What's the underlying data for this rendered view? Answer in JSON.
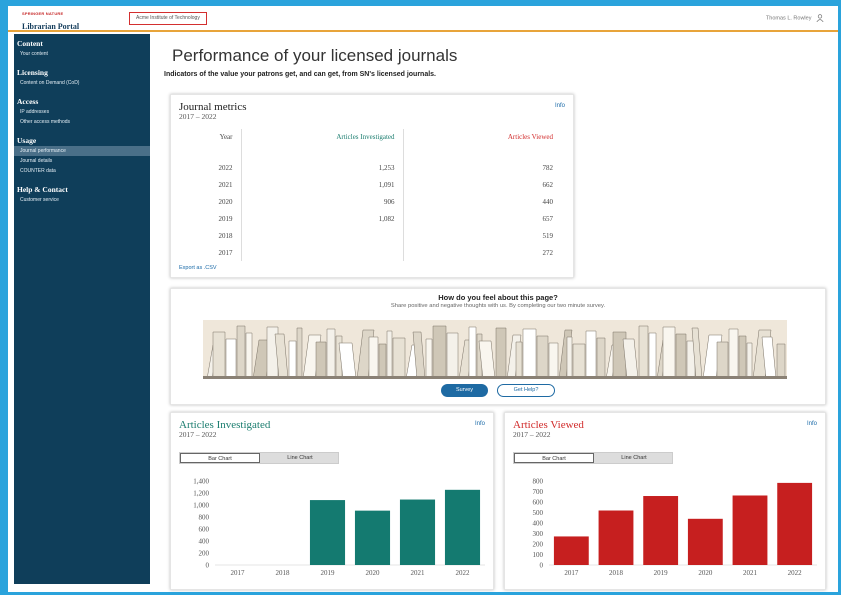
{
  "header": {
    "brand_small": "SPRINGER NATURE",
    "brand_main": "Librarian Portal",
    "institution": "Acme Institute of Technology",
    "user": "Thomas L. Rowley"
  },
  "sidebar": {
    "sections": [
      {
        "heading": "Content",
        "items": [
          {
            "label": "Your content",
            "active": false
          }
        ]
      },
      {
        "heading": "Licensing",
        "items": [
          {
            "label": "Content on Demand (CoD)",
            "active": false
          }
        ]
      },
      {
        "heading": "Access",
        "items": [
          {
            "label": "IP addresses",
            "active": false
          },
          {
            "label": "Other access methods",
            "active": false
          }
        ]
      },
      {
        "heading": "Usage",
        "items": [
          {
            "label": "Journal performance",
            "active": true
          },
          {
            "label": "Journal details",
            "active": false
          },
          {
            "label": "COUNTER data",
            "active": false
          }
        ]
      },
      {
        "heading": "Help & Contact",
        "items": [
          {
            "label": "Customer service",
            "active": false
          }
        ]
      }
    ]
  },
  "page": {
    "title": "Performance of your licensed journals",
    "subtitle": "Indicators of the value your patrons get, and can get, from SN's licensed journals."
  },
  "metrics": {
    "title": "Journal metrics",
    "years": "2017 – 2022",
    "info": "Info",
    "col_year": "Year",
    "col_investigated": "Articles Investigated",
    "col_viewed": "Articles Viewed",
    "rows": [
      {
        "year": "2022",
        "investigated": "1,253",
        "viewed": "782"
      },
      {
        "year": "2021",
        "investigated": "1,091",
        "viewed": "662"
      },
      {
        "year": "2020",
        "investigated": "906",
        "viewed": "440"
      },
      {
        "year": "2019",
        "investigated": "1,082",
        "viewed": "657"
      },
      {
        "year": "2018",
        "investigated": "",
        "viewed": "519"
      },
      {
        "year": "2017",
        "investigated": "",
        "viewed": "272"
      }
    ],
    "export": "Export as .CSV"
  },
  "survey": {
    "title": "How do you feel about this page?",
    "subtitle": "Share positive and negative thoughts with us. By completing our two minute survey.",
    "survey_button": "Survey",
    "help_button": "Get Help?"
  },
  "colors": {
    "investigated": "#147a70",
    "viewed": "#c61f1f"
  },
  "chart_data": [
    {
      "type": "bar",
      "title": "Articles Investigated",
      "years_label": "2017 – 2022",
      "info": "Info",
      "toggle_bar": "Bar Chart",
      "toggle_line": "Line Chart",
      "categories": [
        "2017",
        "2018",
        "2019",
        "2020",
        "2021",
        "2022"
      ],
      "values": [
        0,
        0,
        1082,
        906,
        1091,
        1253
      ],
      "yticks": [
        "1,400",
        "1,200",
        "1,000",
        "800",
        "600",
        "400",
        "200",
        "0"
      ],
      "ylim": [
        0,
        1400
      ],
      "color": "#147a70"
    },
    {
      "type": "bar",
      "title": "Articles Viewed",
      "years_label": "2017 – 2022",
      "info": "Info",
      "toggle_bar": "Bar Chart",
      "toggle_line": "Line Chart",
      "categories": [
        "2017",
        "2018",
        "2019",
        "2020",
        "2021",
        "2022"
      ],
      "values": [
        272,
        519,
        657,
        440,
        662,
        782
      ],
      "yticks": [
        "800",
        "700",
        "600",
        "500",
        "400",
        "300",
        "200",
        "100",
        "0"
      ],
      "ylim": [
        0,
        800
      ],
      "color": "#c61f1f"
    }
  ]
}
